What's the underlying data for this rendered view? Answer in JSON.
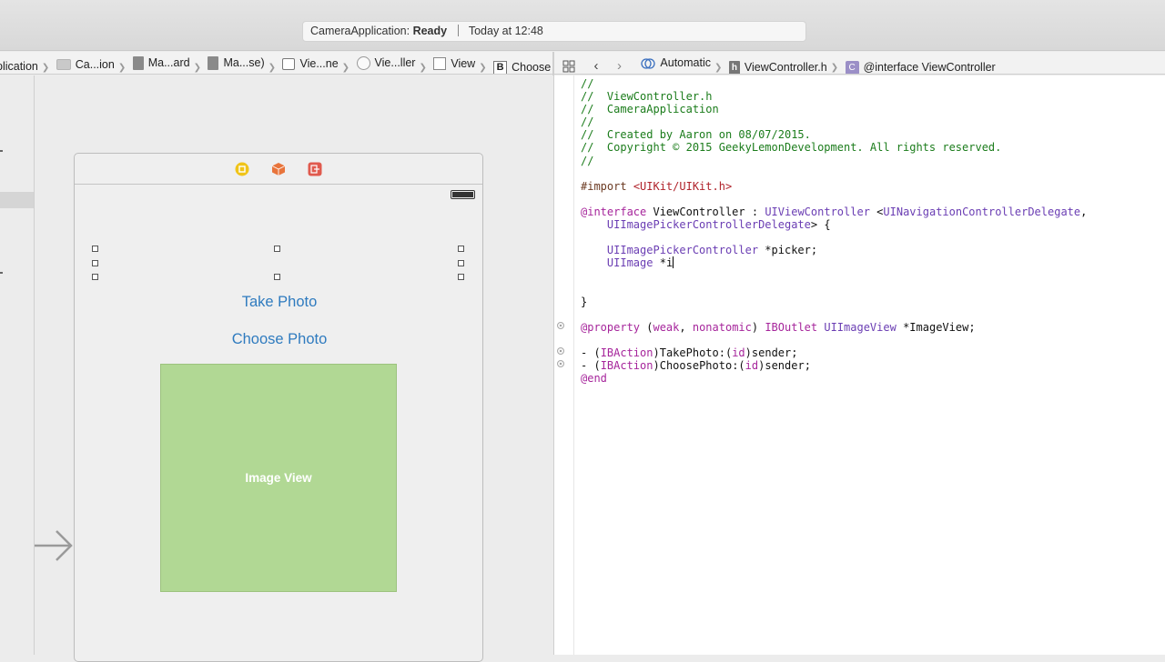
{
  "status": {
    "app_name": "CameraApplication:",
    "state": "Ready",
    "time": "Today at 12:48"
  },
  "jumpbar_left": {
    "items": [
      {
        "label": "plication",
        "icon": "project-icon"
      },
      {
        "label": "Ca...ion",
        "icon": "folder-icon"
      },
      {
        "label": "Ma...ard",
        "icon": "storyboard-file-icon"
      },
      {
        "label": "Ma...se)",
        "icon": "storyboard-file-icon"
      },
      {
        "label": "Vie...ne",
        "icon": "scene-icon"
      },
      {
        "label": "Vie...ller",
        "icon": "view-controller-icon"
      },
      {
        "label": "View",
        "icon": "view-icon"
      },
      {
        "label": "Choose Photo",
        "icon": "button-icon"
      }
    ]
  },
  "jumpbar_right": {
    "mode": "Automatic",
    "file": "ViewController.h",
    "file_icon_letter": "h",
    "symbol_icon_letter": "C",
    "symbol": "@interface ViewController"
  },
  "storyboard": {
    "take_photo": "Take Photo",
    "choose_photo": "Choose Photo",
    "image_view": "Image View",
    "colors": {
      "button_text": "#2f7bbf",
      "image_view_fill": "#b1d894"
    }
  },
  "code": {
    "lines": [
      "//",
      "//  ViewController.h",
      "//  CameraApplication",
      "//",
      "//  Created by Aaron on 08/07/2015.",
      "//  Copyright © 2015 GeekyLemonDevelopment. All rights reserved.",
      "//",
      "",
      "#import <UIKit/UIKit.h>",
      "",
      "@interface ViewController : UIViewController <UINavigationControllerDelegate,",
      "    UIImagePickerControllerDelegate> {",
      "",
      "    UIImagePickerController *picker;",
      "    UIImage *i",
      "",
      "",
      "}",
      "",
      "@property (weak, nonatomic) IBOutlet UIImageView *ImageView;",
      "",
      "- (IBAction)TakePhoto:(id)sender;",
      "- (IBAction)ChoosePhoto:(id)sender;",
      "@end"
    ]
  }
}
